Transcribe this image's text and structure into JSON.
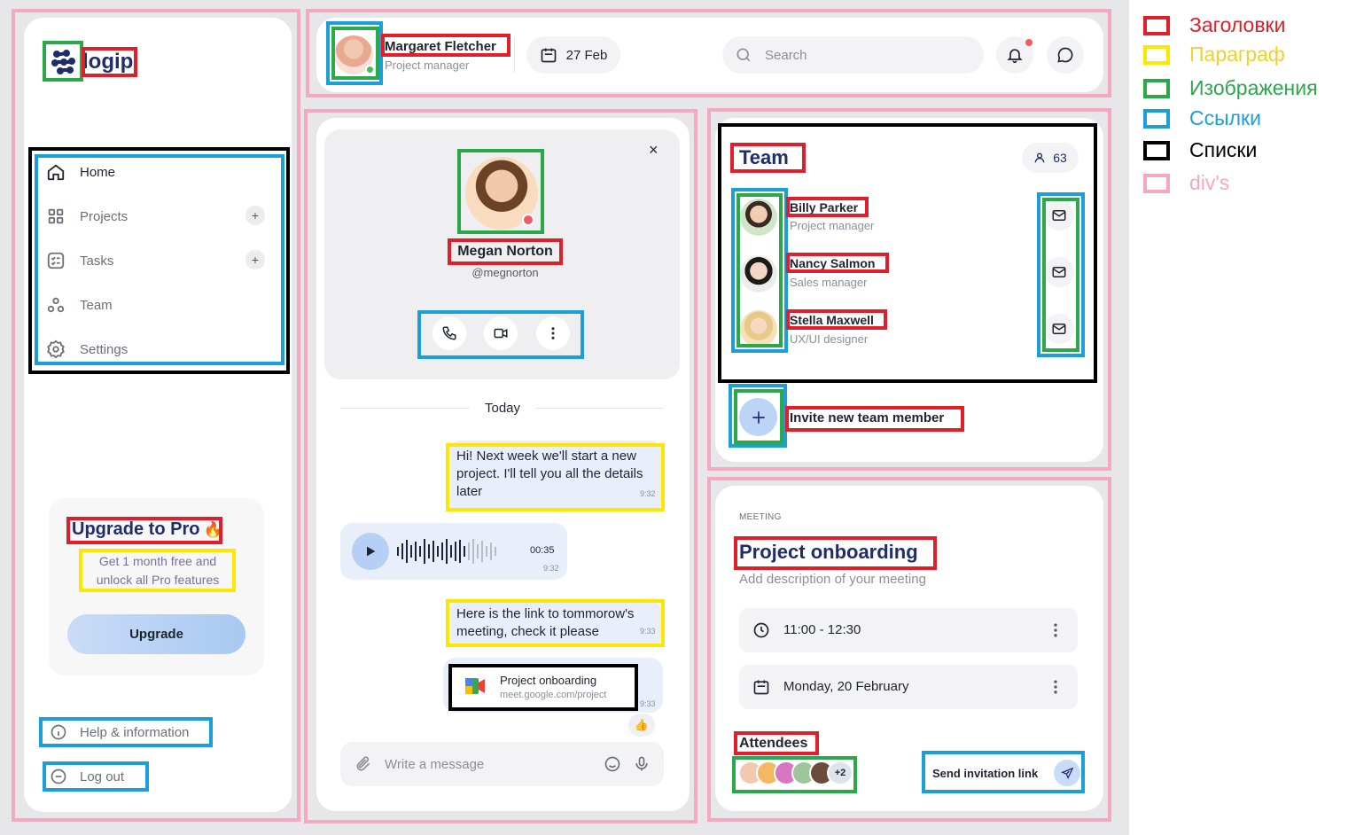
{
  "brand": {
    "name": "logip"
  },
  "header": {
    "user_name": "Margaret Fletcher",
    "user_role": "Project manager",
    "date": "27 Feb",
    "search_placeholder": "Search"
  },
  "sidebar": {
    "items": [
      {
        "label": "Home",
        "icon": "home-icon"
      },
      {
        "label": "Projects",
        "icon": "grid-icon"
      },
      {
        "label": "Tasks",
        "icon": "checklist-icon"
      },
      {
        "label": "Team",
        "icon": "team-icon"
      },
      {
        "label": "Settings",
        "icon": "gear-icon"
      }
    ],
    "promo": {
      "title": "Upgrade to Pro",
      "emoji": "🔥",
      "text": "Get 1 month free and unlock all Pro features",
      "button": "Upgrade"
    },
    "help": "Help & information",
    "logout": "Log out"
  },
  "chat": {
    "contact_name": "Megan Norton",
    "contact_handle": "@megnorton",
    "divider": "Today",
    "messages": [
      {
        "text": "Hi! Next week we'll start a new project. I'll tell you all the details later",
        "time": "9:32"
      },
      {
        "voice_duration": "00:35",
        "time": "9:32"
      },
      {
        "text": "Here is the link to tommorow's meeting, check it please",
        "time": "9:33"
      },
      {
        "link_title": "Project onboarding",
        "link_url": "meet.google.com/project",
        "time": "9:33",
        "reaction": "👍"
      }
    ],
    "input_placeholder": "Write a message"
  },
  "team": {
    "title": "Team",
    "count": "63",
    "members": [
      {
        "name": "Billy Parker",
        "role": "Project manager"
      },
      {
        "name": "Nancy Salmon",
        "role": "Sales manager"
      },
      {
        "name": "Stella Maxwell",
        "role": "UX/UI designer"
      }
    ],
    "invite": "Invite new team member"
  },
  "meeting": {
    "eyebrow": "MEETING",
    "title": "Project onboarding",
    "description": "Add description of your meeting",
    "time": "11:00 - 12:30",
    "date": "Monday, 20 February",
    "attendees_label": "Attendees",
    "extra_count": "+2",
    "send_link": "Send invitation link"
  },
  "legend": [
    {
      "label": "Заголовки",
      "color": "#e11f2a"
    },
    {
      "label": "Параграф",
      "color": "#ffe600"
    },
    {
      "label": "Изображения",
      "color": "#2aa84a"
    },
    {
      "label": "Ссылки",
      "color": "#1b9fd8"
    },
    {
      "label": "Списки",
      "color": "#000000"
    },
    {
      "label": "div's",
      "color": "#f4a9c0"
    }
  ],
  "colors": {
    "accent": "#1f2d6b",
    "bubble": "#e8effb",
    "button_gradient_start": "#c9dcf7",
    "button_gradient_end": "#a9c9f2",
    "notification_dot": "#f25a64",
    "online": "#3cc35b"
  }
}
